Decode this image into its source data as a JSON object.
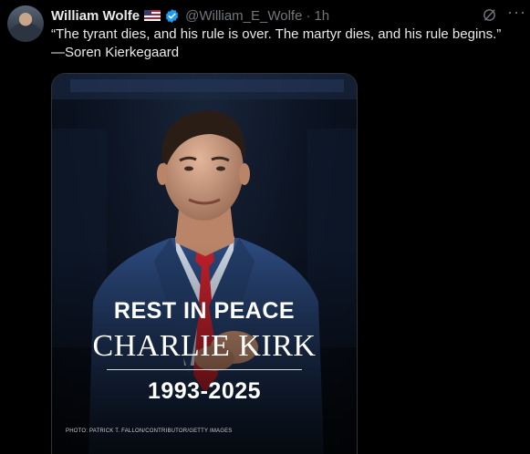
{
  "post": {
    "author_name": "William Wolfe",
    "handle": "@William_E_Wolfe",
    "separator": "·",
    "time": "1h",
    "text_line1": "“The tyrant dies, and his rule is over. The martyr dies, and his rule begins.”",
    "text_line2": "—Soren Kierkegaard",
    "badges": [
      "us-flag-icon",
      "verified-badge-icon"
    ]
  },
  "media": {
    "headline": "REST IN PEACE",
    "person_name": "CHARLIE KIRK",
    "years": "1993-2025",
    "credit": "PHOTO: PATRICK T. FALLON/CONTRIBUTOR/GETTY IMAGES"
  },
  "colors": {
    "background": "#000000",
    "text": "#e7e9ea",
    "muted": "#71767b",
    "verified": "#1d9bf0",
    "tie": "#c0202a"
  }
}
